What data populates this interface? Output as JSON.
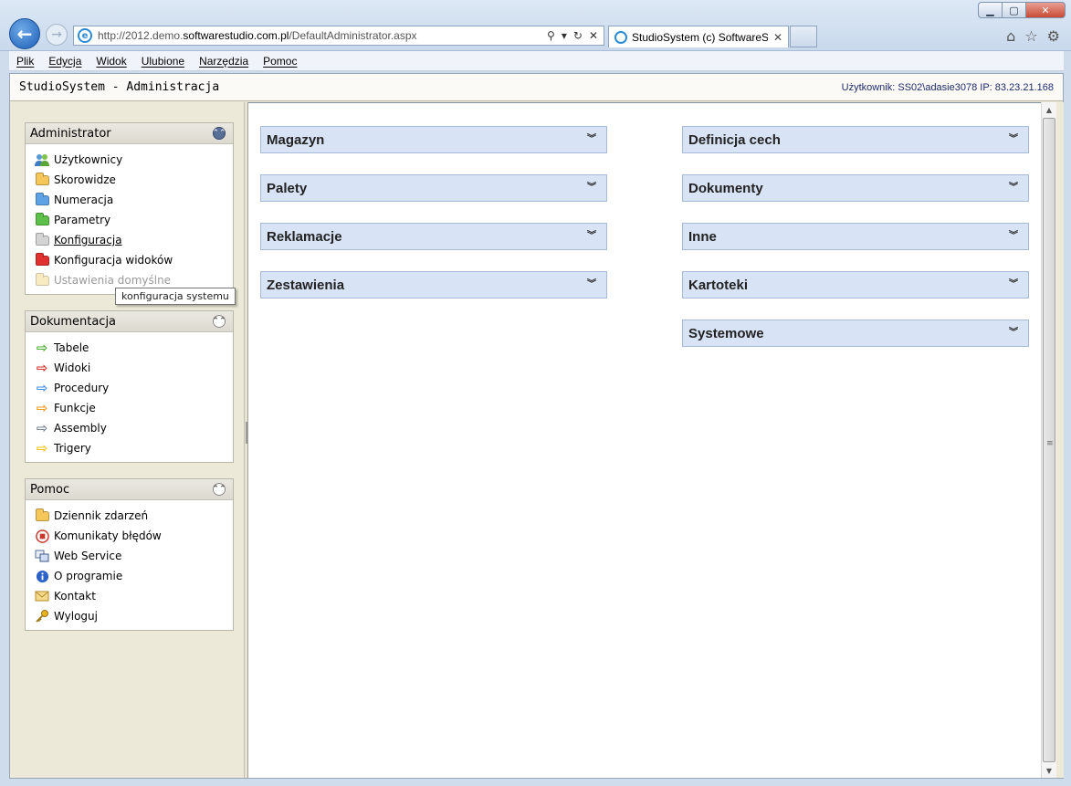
{
  "browser": {
    "url_prefix": "http://2012.demo.",
    "url_domain": "softwarestudio.com.pl",
    "url_path": "/DefaultAdministrator.aspx",
    "tab_title": "StudioSystem (c) SoftwareS...",
    "tab_close": "✕",
    "menu": [
      "Plik",
      "Edycja",
      "Widok",
      "Ulubione",
      "Narzędzia",
      "Pomoc"
    ]
  },
  "app": {
    "title": "StudioSystem - Administracja",
    "user_info": "Użytkownik: SS02\\adasie3078 IP: 83.23.21.168"
  },
  "sidebar": {
    "administrator": {
      "title": "Administrator",
      "items": [
        "Użytkownicy",
        "Skorowidze",
        "Numeracja",
        "Parametry",
        "Konfiguracja",
        "Konfiguracja widoków",
        "Ustawienia domyślne"
      ]
    },
    "dokumentacja": {
      "title": "Dokumentacja",
      "items": [
        "Tabele",
        "Widoki",
        "Procedury",
        "Funkcje",
        "Assembly",
        "Trigery"
      ]
    },
    "pomoc": {
      "title": "Pomoc",
      "items": [
        "Dziennik zdarzeń",
        "Komunikaty błędów",
        "Web Service",
        "O programie",
        "Kontakt",
        "Wyloguj"
      ]
    },
    "tooltip": "konfiguracja systemu"
  },
  "sections": {
    "left": [
      "Magazyn",
      "Palety",
      "Reklamacje",
      "Zestawienia"
    ],
    "right": [
      "Definicja cech",
      "Dokumenty",
      "Inne",
      "Kartoteki",
      "Systemowe"
    ]
  },
  "colors": {
    "section_bg": "#d8e4f5",
    "section_border": "#a7bbd9",
    "sidebar_bg": "#ece9d8"
  }
}
